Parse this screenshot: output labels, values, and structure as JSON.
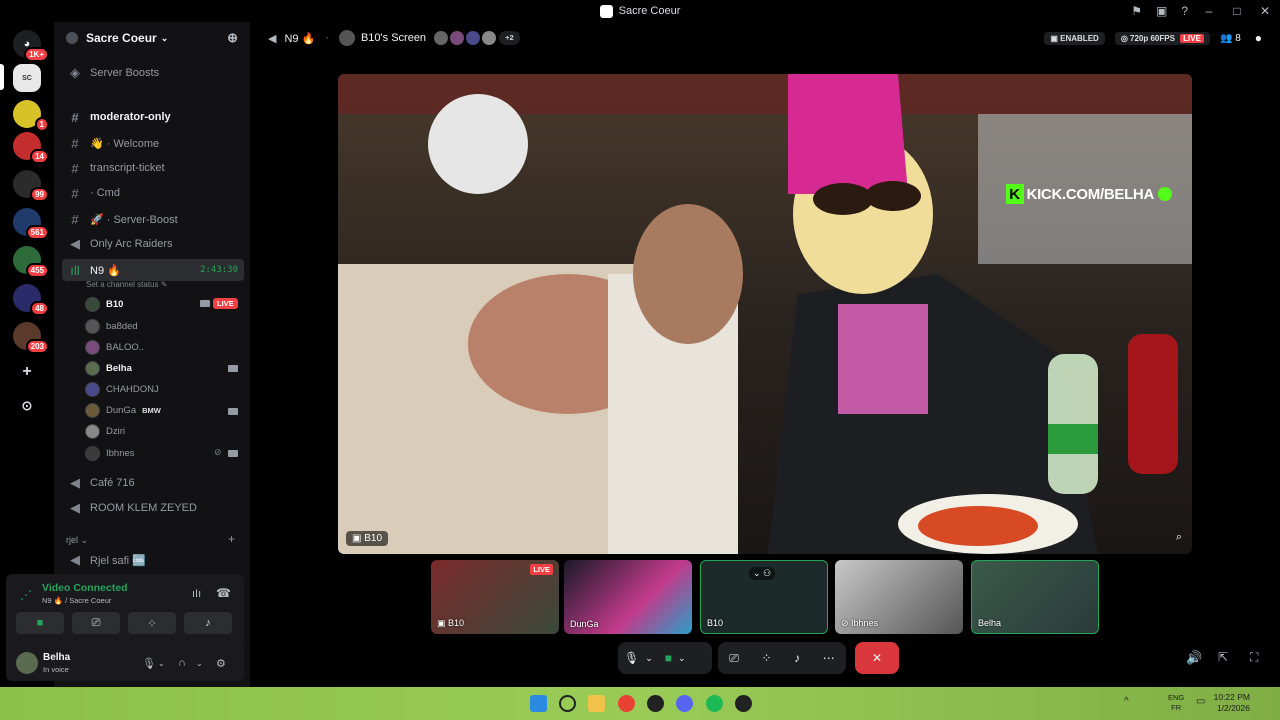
{
  "window": {
    "title": "Sacre Coeur"
  },
  "servers": {
    "badges": [
      "1K+",
      "1",
      "14",
      "99",
      "561",
      "455",
      "48",
      "203"
    ]
  },
  "sidebar": {
    "guild_name": "Sacre Coeur",
    "boosts_label": "Server Boosts",
    "channels": [
      {
        "name": "moderator-only"
      },
      {
        "name": "👋 · Welcome"
      },
      {
        "name": "transcript-ticket"
      },
      {
        "name": "· Cmd"
      },
      {
        "name": "🚀 · Server-Boost"
      },
      {
        "name": "Only Arc Raiders"
      }
    ],
    "voice_channel": {
      "name": "N9 🔥",
      "time": "2:43:30",
      "status_hint": "Set a channel status"
    },
    "members": [
      {
        "name": "B10",
        "live": "LIVE"
      },
      {
        "name": "ba8ded"
      },
      {
        "name": "BALOO.."
      },
      {
        "name": "Belha"
      },
      {
        "name": "CHAHDONJ"
      },
      {
        "name": "DunGa",
        "tag": "BMW"
      },
      {
        "name": "Dziri"
      },
      {
        "name": "Ibhnes"
      }
    ],
    "voice_channels_more": [
      "Café 716",
      "ROOM KLEM ZEYED"
    ],
    "category": "rjel",
    "rjel_channel": "Rjel safi 🆒"
  },
  "voice_panel": {
    "title": "Video Connected",
    "subtitle": "N9 🔥 / Sacre Coeur"
  },
  "user_panel": {
    "name": "Belha",
    "status": "In voice"
  },
  "topbar": {
    "channel": "N9 🔥",
    "screen_label": "B10's Screen",
    "extra_viewers": "+2",
    "enabled_label": "ENABLED",
    "quality_label": "720p 60FPS",
    "live_label": "LIVE",
    "member_count": "8"
  },
  "stage": {
    "label": "B10",
    "overlay_text": "KICK.COM/BELHA"
  },
  "tiles": [
    {
      "label": "B10",
      "live": "LIVE"
    },
    {
      "label": "DunGa"
    },
    {
      "label": "B10"
    },
    {
      "label": "Ibhnes"
    },
    {
      "label": "Belha"
    }
  ],
  "taskbar": {
    "lang_top": "ENG",
    "lang_bottom": "FR",
    "time": "10:22 PM",
    "date": "1/2/2026"
  }
}
